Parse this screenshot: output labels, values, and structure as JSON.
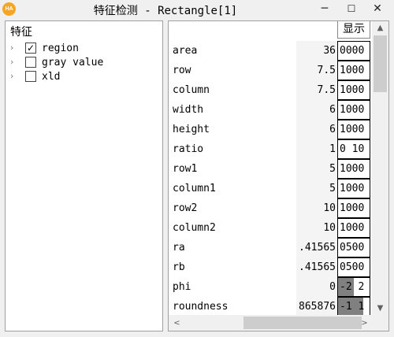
{
  "window": {
    "app_icon_text": "HA",
    "title": "特征检测 - Rectangle[1]",
    "minimize_glyph": "─",
    "maximize_glyph": "☐",
    "close_glyph": "✕"
  },
  "feature_tree": {
    "header": "特征",
    "expander_glyph": "›",
    "check_glyph": "✓",
    "items": [
      {
        "label": "region",
        "checked": true
      },
      {
        "label": "gray value",
        "checked": false
      },
      {
        "label": "xld",
        "checked": false
      }
    ]
  },
  "grid": {
    "show_header": "显示",
    "rows": [
      {
        "name": "area",
        "value": "36",
        "show": "0000"
      },
      {
        "name": "row",
        "value": "7.5",
        "show": "1000"
      },
      {
        "name": "column",
        "value": "7.5",
        "show": "1000"
      },
      {
        "name": "width",
        "value": "6",
        "show": "1000"
      },
      {
        "name": "height",
        "value": "6",
        "show": "1000"
      },
      {
        "name": "ratio",
        "value": "1",
        "show": "0 10"
      },
      {
        "name": "row1",
        "value": "5",
        "show": "1000"
      },
      {
        "name": "column1",
        "value": "5",
        "show": "1000"
      },
      {
        "name": "row2",
        "value": "10",
        "show": "1000"
      },
      {
        "name": "column2",
        "value": "10",
        "show": "1000"
      },
      {
        "name": "ra",
        "value": ".41565",
        "show": "0500"
      },
      {
        "name": "rb",
        "value": ".41565",
        "show": "0500"
      },
      {
        "name": "phi",
        "value": "0",
        "show": "-2  2"
      },
      {
        "name": "roundness",
        "value": "865876",
        "show": "-1 1"
      }
    ]
  },
  "scrollbars": {
    "up_glyph": "▲",
    "down_glyph": "▼",
    "left_glyph": "<",
    "right_glyph": ">"
  }
}
